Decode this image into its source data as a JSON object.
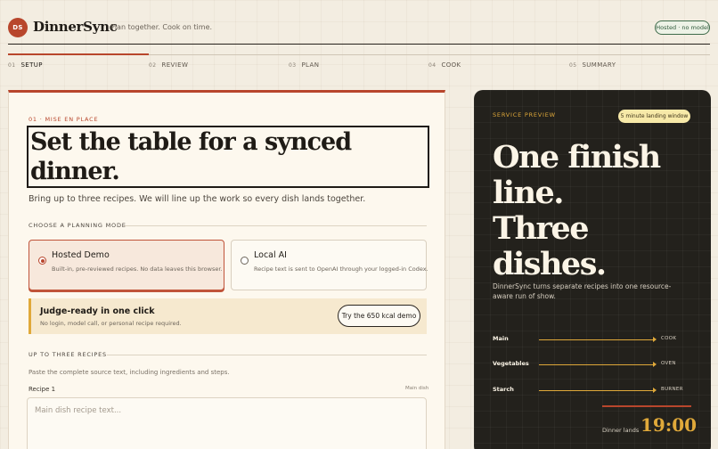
{
  "header": {
    "logo_initials": "DS",
    "brand": "DinnerSync",
    "tagline": "Plan together. Cook on time.",
    "status_pill": "Hosted · no model"
  },
  "steps": [
    {
      "num": "01",
      "label": "Setup",
      "active": true
    },
    {
      "num": "02",
      "label": "Review",
      "active": false
    },
    {
      "num": "03",
      "label": "Plan",
      "active": false
    },
    {
      "num": "04",
      "label": "Cook",
      "active": false
    },
    {
      "num": "05",
      "label": "Summary",
      "active": false
    }
  ],
  "setup": {
    "eyebrow": "01 · Mise en place",
    "headline": "Set the table for a synced dinner.",
    "subhead": "Bring up to three recipes. We will line up the work so every dish lands together.",
    "mode_section_label": "Choose a planning mode",
    "modes": [
      {
        "title": "Hosted Demo",
        "desc": "Built-in, pre-reviewed recipes. No data leaves this browser.",
        "selected": true
      },
      {
        "title": "Local AI",
        "desc": "Recipe text is sent to OpenAI through your logged-in Codex.",
        "selected": false
      }
    ],
    "judge": {
      "title": "Judge-ready in one click",
      "desc": "No login, model call, or personal recipe required.",
      "button": "Try the 650 kcal demo"
    },
    "recipes_section_label": "Up to three recipes",
    "paste_hint": "Paste the complete source text, including ingredients and steps.",
    "recipe1": {
      "label": "Recipe 1",
      "tag": "Main dish",
      "value": "",
      "placeholder": "Main dish recipe text..."
    }
  },
  "preview": {
    "label": "Service preview",
    "window_pill": "5 minute landing window",
    "big_lines": [
      "One finish",
      "line.",
      "Three",
      "dishes."
    ],
    "desc": "DinnerSync turns separate recipes into one resource-aware run of show.",
    "tracks": [
      {
        "name": "Main",
        "resource": "COOK"
      },
      {
        "name": "Vegetables",
        "resource": "OVEN"
      },
      {
        "name": "Starch",
        "resource": "BURNER"
      }
    ],
    "dinner_label": "Dinner lands",
    "dinner_time": "19:00"
  },
  "colors": {
    "accent": "#b8462c",
    "gold": "#e0a93a",
    "dark_panel": "#23211c",
    "background": "#f3ede1"
  }
}
